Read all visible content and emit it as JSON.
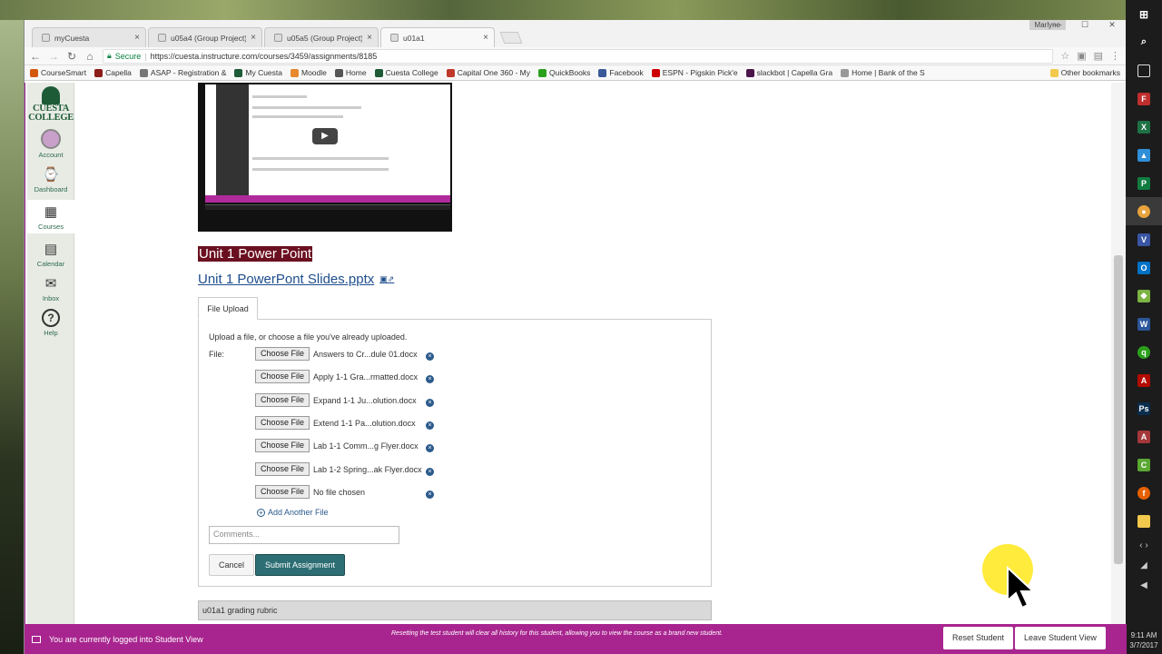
{
  "browser": {
    "tabs": [
      {
        "title": "myCuesta",
        "close": "×"
      },
      {
        "title": "u05a4 (Group Project)",
        "close": "×"
      },
      {
        "title": "u05a5 (Group Project)",
        "close": "×"
      },
      {
        "title": "u01a1",
        "close": "×"
      }
    ],
    "profile": "Marlyne",
    "window_controls": [
      "—",
      "☐",
      "✕"
    ],
    "secure_label": "Secure",
    "url": "https://cuesta.instructure.com/courses/3459/assignments/8185",
    "bookmarks": [
      {
        "label": "CourseSmart",
        "color": "#d4570e"
      },
      {
        "label": "Capella",
        "color": "#8c1d18"
      },
      {
        "label": "ASAP - Registration &",
        "color": "#777777"
      },
      {
        "label": "My Cuesta",
        "color": "#1d5b37"
      },
      {
        "label": "Moodle",
        "color": "#e8882f"
      },
      {
        "label": "Home",
        "color": "#555555"
      },
      {
        "label": "Cuesta College",
        "color": "#1d5b37"
      },
      {
        "label": "Capital One 360 - My",
        "color": "#c0392b"
      },
      {
        "label": "QuickBooks",
        "color": "#2ca01c"
      },
      {
        "label": "Facebook",
        "color": "#3b5998"
      },
      {
        "label": "ESPN - Pigskin Pick'e",
        "color": "#cc0000"
      },
      {
        "label": "slackbot | Capella Gra",
        "color": "#4a154b"
      },
      {
        "label": "Home | Bank of the S",
        "color": "#999999"
      }
    ],
    "other_bookmarks": "Other bookmarks"
  },
  "sidebar": {
    "logo_line1": "CUESTA",
    "logo_line2": "COLLEGE",
    "items": [
      {
        "label": "Account",
        "icon": "avatar"
      },
      {
        "label": "Dashboard",
        "icon": "⌚"
      },
      {
        "label": "Courses",
        "icon": "▦"
      },
      {
        "label": "Calendar",
        "icon": "▤"
      },
      {
        "label": "Inbox",
        "icon": "✉"
      },
      {
        "label": "Help",
        "icon": "?"
      }
    ]
  },
  "main": {
    "ppt_heading": "Unit 1 Power Point",
    "ppt_link": "Unit 1 PowerPont Slides.pptx",
    "upload_tab": "File Upload",
    "upload_hint": "Upload a file, or choose a file you've already uploaded.",
    "file_label": "File:",
    "choose_label": "Choose File",
    "files": [
      "Answers to Cr...dule 01.docx",
      "Apply 1-1 Gra...rmatted.docx",
      "Expand 1-1 Ju...olution.docx",
      "Extend 1-1 Pa...olution.docx",
      "Lab 1-1 Comm...g Flyer.docx",
      "Lab 1-2 Spring...ak Flyer.docx",
      "No file chosen"
    ],
    "add_another": "Add Another File",
    "comments_placeholder": "Comments...",
    "cancel": "Cancel",
    "submit": "Submit Assignment",
    "rubric": "u01a1 grading rubric"
  },
  "student_view": {
    "message": "You are currently logged into Student View",
    "note": "Resetting the test student will clear all history for this student, allowing you to view the course as a brand new student.",
    "reset": "Reset Student",
    "leave": "Leave Student View"
  },
  "taskbar": {
    "time": "9:11 AM",
    "date": "3/7/2017"
  }
}
